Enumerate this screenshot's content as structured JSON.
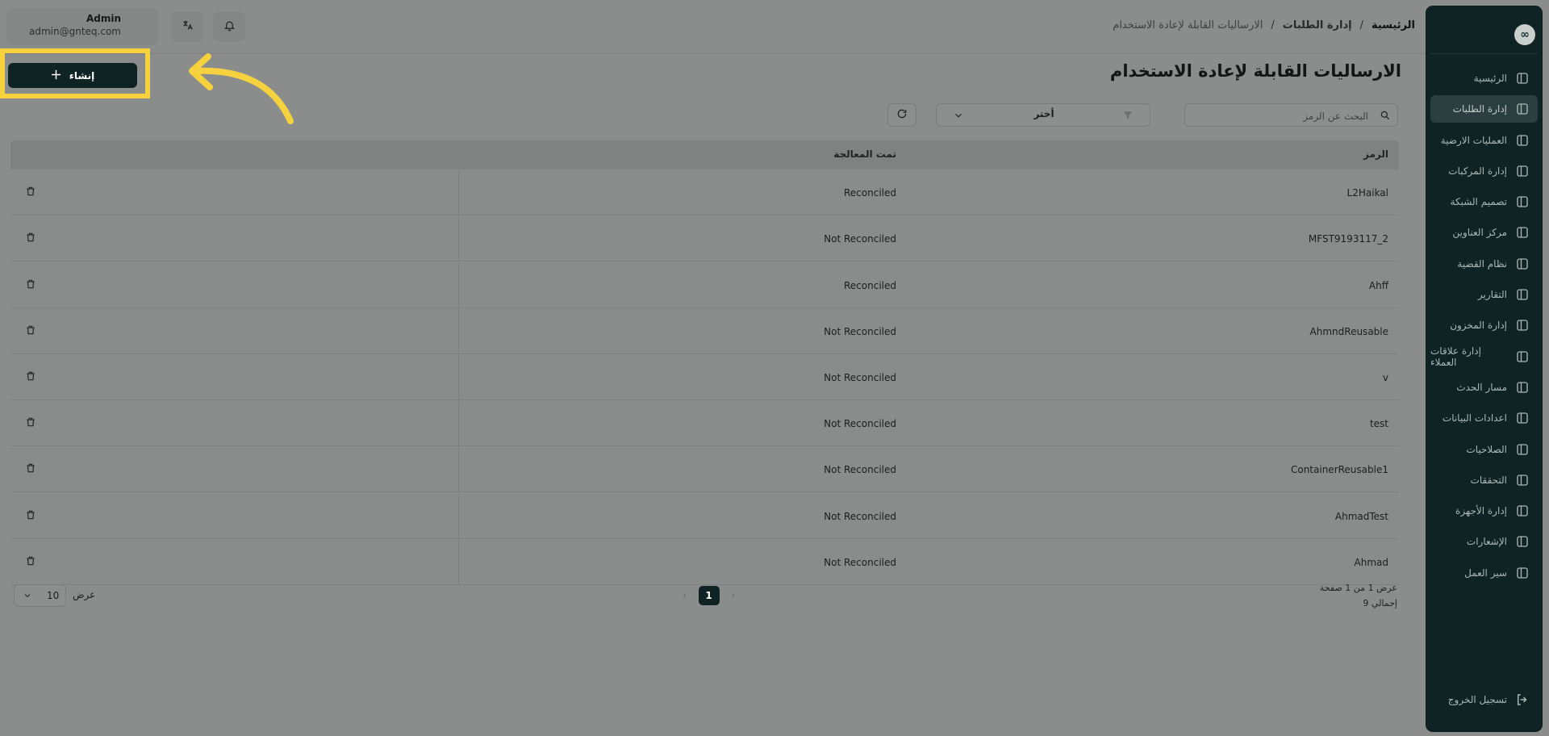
{
  "sidebar": {
    "logo": "∞",
    "items": [
      {
        "label": "الرئيسية",
        "icon": "layout-icon"
      },
      {
        "label": "إدارة الطلبات",
        "icon": "orders-icon",
        "active": true
      },
      {
        "label": "العمليات الارضية",
        "icon": "ground-ops-icon"
      },
      {
        "label": "إدارة المركبات",
        "icon": "truck-icon"
      },
      {
        "label": "تصميم الشبكة",
        "icon": "network-icon"
      },
      {
        "label": "مركز العناوين",
        "icon": "location-icon"
      },
      {
        "label": "نظام القضية",
        "icon": "case-icon"
      },
      {
        "label": "التقارير",
        "icon": "report-icon"
      },
      {
        "label": "إدارة المخزون",
        "icon": "inventory-icon"
      },
      {
        "label": "إدارة علاقات العملاء",
        "icon": "crm-icon"
      },
      {
        "label": "مسار الحدث",
        "icon": "route-icon"
      },
      {
        "label": "اعدادات البيانات",
        "icon": "database-icon"
      },
      {
        "label": "الصلاحيات",
        "icon": "users-icon"
      },
      {
        "label": "التحققات",
        "icon": "tools-icon"
      },
      {
        "label": "إدارة الأجهزة",
        "icon": "device-icon"
      },
      {
        "label": "الإشعارات",
        "icon": "bell-icon"
      },
      {
        "label": "سير العمل",
        "icon": "workflow-icon"
      }
    ],
    "logout": "تسجيل الخروج"
  },
  "header": {
    "breadcrumb": [
      "الرئيسية",
      "إدارة الطلبات",
      "الارساليات القابلة لإعادة الاستخدام"
    ],
    "separator": "/",
    "user_name": "Admin",
    "user_email": "admin@gnteq.com"
  },
  "page": {
    "title": "الارساليات القابلة لإعادة الاستخدام",
    "create_label": "إنشاء",
    "search_placeholder": "البحث عن الرمز",
    "filter_value": "أختر"
  },
  "table": {
    "headers": {
      "code": "الرمز",
      "processed": "تمت المعالجة"
    },
    "rows": [
      {
        "code": "L2Haikal",
        "processed": "Reconciled"
      },
      {
        "code": "MFST9193117_2",
        "processed": "Not Reconciled"
      },
      {
        "code": "Ahff",
        "processed": "Reconciled"
      },
      {
        "code": "AhmndReusable",
        "processed": "Not Reconciled"
      },
      {
        "code": "v",
        "processed": "Not Reconciled"
      },
      {
        "code": "test",
        "processed": "Not Reconciled"
      },
      {
        "code": "ContainerReusable1",
        "processed": "Not Reconciled"
      },
      {
        "code": "AhmadTest",
        "processed": "Not Reconciled"
      },
      {
        "code": "Ahmad",
        "processed": "Not Reconciled"
      }
    ]
  },
  "footer": {
    "page_info": "عرض 1 من 1 صفحة",
    "total": "إجمالي 9",
    "current_page": "1",
    "page_size": "10",
    "show_label": "عرض"
  },
  "colors": {
    "accent": "#0f2324",
    "highlight": "#f5d23e"
  }
}
